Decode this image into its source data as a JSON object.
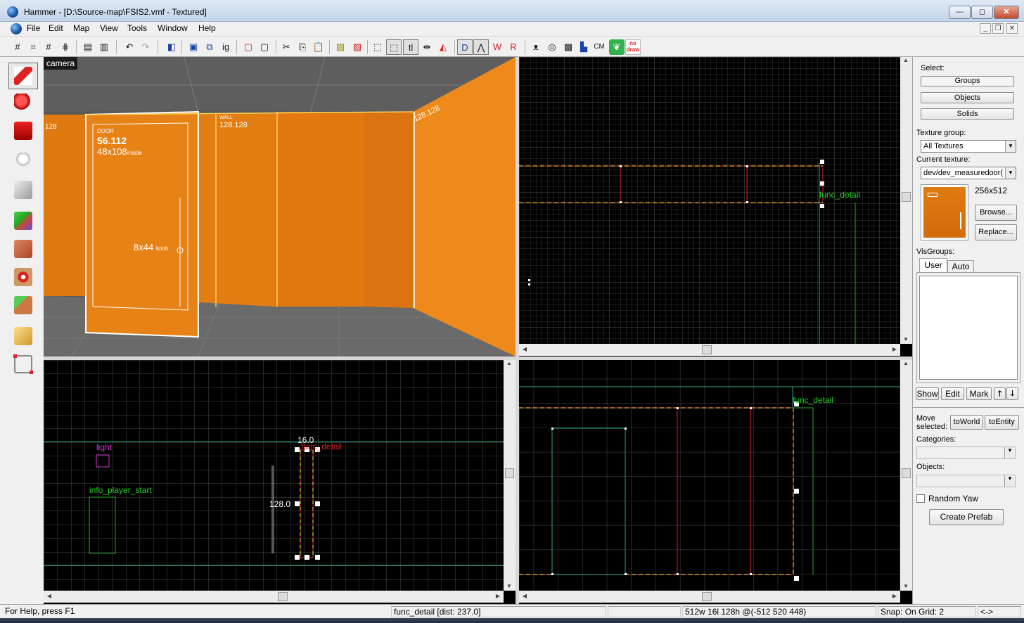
{
  "window": {
    "title": "Hammer - [D:\\Source-map\\FSIS2.vmf - Textured]",
    "min_label": "—",
    "max_label": "◻",
    "close_label": "✕"
  },
  "menu": {
    "items": [
      "File",
      "Edit",
      "Map",
      "View",
      "Tools",
      "Window",
      "Help"
    ]
  },
  "toolbar": {
    "icons": [
      "grid-icon",
      "grid-smaller-icon",
      "grid-larger-icon",
      "grid-dots-icon",
      "group-icon",
      "ungroup-icon",
      "undo-icon",
      "redo-icon",
      "carve-icon",
      "hollow-icon",
      "texture-lock-icon",
      "ignore-groups-icon",
      "cut-icon",
      "copy-icon",
      "paste-icon",
      "hide-selected-icon",
      "hide-unselected-icon",
      "bounding-box-icon",
      "select-icon",
      "texture-lock-icon-2",
      "flip-icon",
      "align-icon",
      "3d-wireframe-icon",
      "3d-polygon-icon",
      "3d-textured-icon",
      "3d-lightmap-icon",
      "lightmap-icon",
      "circle-icon",
      "terrain-icon",
      "displacement-icon",
      "cordon-icon",
      "texture-browser-icon",
      "nodraw-icon"
    ],
    "labels": {
      "ig": "ig",
      "tl": "tl",
      "cm": "CM",
      "nodraw": "no draw"
    }
  },
  "left_tools": [
    "selection-tool-icon",
    "magnify-tool-icon",
    "camera-tool-icon",
    "entity-tool-icon",
    "block-tool-icon",
    "texture-application-icon",
    "apply-texture-icon",
    "decal-tool-icon",
    "overlay-tool-icon",
    "clipping-tool-icon",
    "vertex-tool-icon"
  ],
  "viewports": {
    "camera": {
      "label": "camera",
      "door_text_1": "DOOR",
      "door_text_2": "56.112",
      "door_text_3": "48x108",
      "door_text_3b": "inside",
      "wall_text_1": "WALL",
      "wall_text_2": "128.128",
      "knob_text": "8x44",
      "knob_text_b": "knob",
      "left_text": "128",
      "right_text": "128.128"
    },
    "top_right": {
      "entity_label": "func_detail"
    },
    "bottom_left": {
      "light_label": "light",
      "player_label": "info_player_start",
      "detail_label": "func_detail",
      "dim_width": "16.0",
      "dim_height": "128.0"
    },
    "bottom_right": {
      "entity_label": "func_detail"
    }
  },
  "right_panel": {
    "select_label": "Select:",
    "buttons": {
      "groups": "Groups",
      "objects": "Objects",
      "solids": "Solids"
    },
    "texture_group_label": "Texture group:",
    "texture_group_value": "All Textures",
    "current_texture_label": "Current texture:",
    "current_texture_value": "dev/dev_measuredoor(",
    "texture_size": "256x512",
    "browse_label": "Browse...",
    "replace_label": "Replace...",
    "visgroups_label": "VisGroups:",
    "tabs": [
      "User",
      "Auto"
    ],
    "show_label": "Show",
    "edit_label": "Edit",
    "mark_label": "Mark",
    "up_label": "🡑",
    "down_label": "🡓",
    "move_selected_label": "Move selected:",
    "to_world_label": "toWorld",
    "to_entity_label": "toEntity",
    "categories_label": "Categories:",
    "objects_label": "Objects:",
    "random_yaw_label": "Random Yaw",
    "create_prefab_label": "Create Prefab"
  },
  "status": {
    "help": "For Help, press F1",
    "selection": "func_detail   [dist: 237.0]",
    "size": "512w 16l 128h @(-512 520 448)",
    "snap": "Snap: On Grid: 2",
    "arrows": "<->"
  },
  "colors": {
    "wall_orange": "#e07a10",
    "grid_line": "#3a3a3a",
    "accent_green": "#22cc22",
    "selection_red": "#dd2222"
  }
}
